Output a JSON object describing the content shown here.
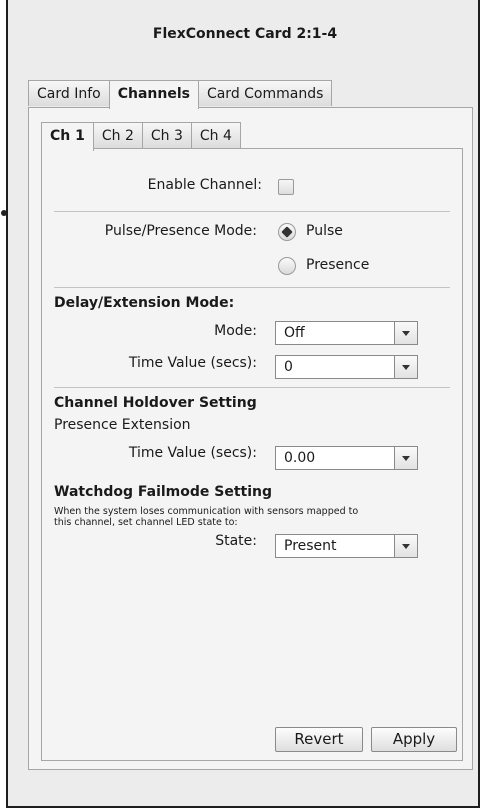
{
  "window": {
    "title": "FlexConnect Card 2:1-4"
  },
  "outer_tabs": [
    {
      "label": "Card Info",
      "active": false
    },
    {
      "label": "Channels",
      "active": true
    },
    {
      "label": "Card Commands",
      "active": false
    }
  ],
  "inner_tabs": [
    {
      "label": "Ch 1",
      "active": true
    },
    {
      "label": "Ch 2",
      "active": false
    },
    {
      "label": "Ch 3",
      "active": false
    },
    {
      "label": "Ch 4",
      "active": false
    }
  ],
  "enable_channel": {
    "label": "Enable Channel:",
    "checked": false
  },
  "pulse_presence": {
    "label": "Pulse/Presence Mode:",
    "options": [
      "Pulse",
      "Presence"
    ],
    "selected": "Pulse"
  },
  "delay_extension": {
    "heading": "Delay/Extension Mode:",
    "mode_label": "Mode:",
    "mode_value": "Off",
    "time_label": "Time Value (secs):",
    "time_value": "0"
  },
  "holdover": {
    "heading": "Channel Holdover Setting",
    "subheading": "Presence Extension",
    "time_label": "Time Value (secs):",
    "time_value": "0.00"
  },
  "watchdog": {
    "heading": "Watchdog Failmode Setting",
    "description_line1": "When the system loses communication with sensors mapped to",
    "description_line2": "this channel, set channel LED state to:",
    "state_label": "State:",
    "state_value": "Present"
  },
  "buttons": {
    "revert": "Revert",
    "apply": "Apply"
  }
}
